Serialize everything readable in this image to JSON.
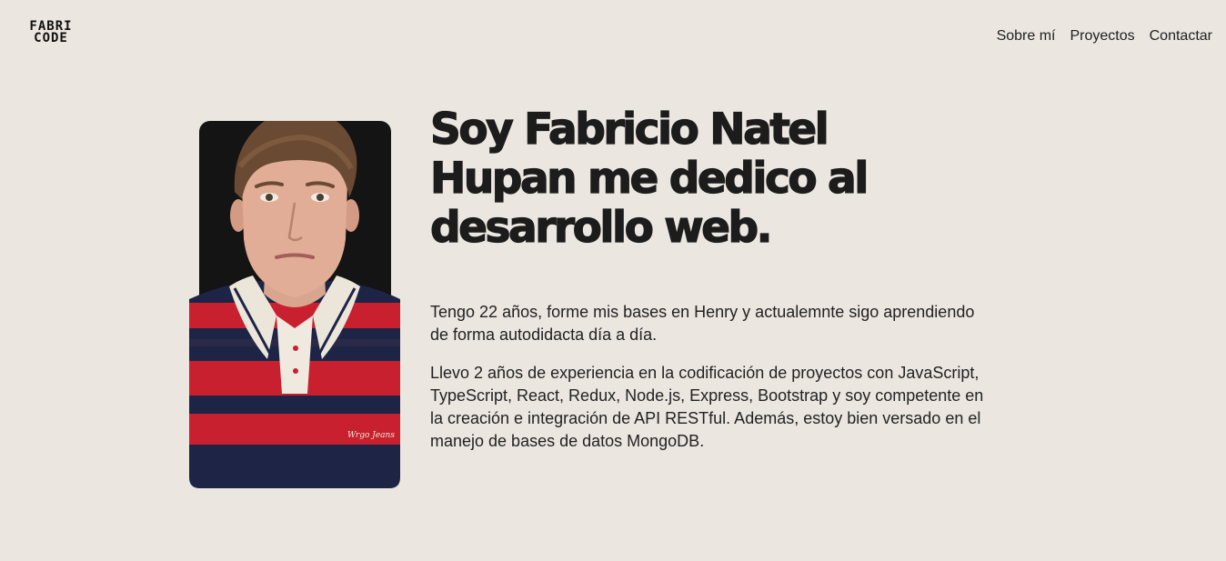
{
  "header": {
    "logo_line1": "FABRI",
    "logo_line2": "CODE",
    "nav": [
      {
        "label": "Sobre mí"
      },
      {
        "label": "Proyectos"
      },
      {
        "label": "Contactar"
      }
    ]
  },
  "hero": {
    "headline_line1": "Soy Fabricio Natel",
    "headline_line2": "Hupan me dedico al",
    "headline_line3": "desarrollo web.",
    "paragraph1_line1": "Tengo 22 años, forme mis bases en Henry y actualemnte sigo aprendiendo",
    "paragraph1_line2": "de forma autodidacta día a día.",
    "paragraph2_line1": "Llevo 2 años de experiencia en la codificación de proyectos con JavaScript,",
    "paragraph2_line2": "TypeScript, React, Redux, Node.js, Express, Bootstrap y soy competente en",
    "paragraph2_line3": "la creación e integración de API RESTful. Además, estoy bien versado en el",
    "paragraph2_line4": "manejo de bases de datos MongoDB.",
    "shirt_brand": "Wrgo Jeans"
  },
  "colors": {
    "background": "#ebe6e0",
    "text": "#1f1f1f",
    "shirt_red": "#c8202e",
    "shirt_navy": "#1d2446",
    "photo_backdrop": "#141414"
  }
}
